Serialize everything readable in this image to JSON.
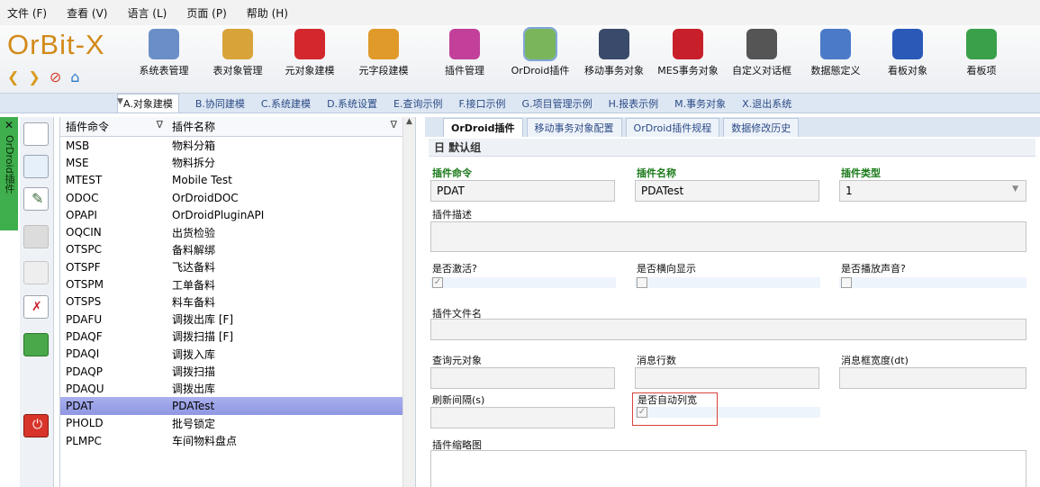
{
  "menu": [
    "文件 (F)",
    "查看 (V)",
    "语言 (L)",
    "页面 (P)",
    "帮助 (H)"
  ],
  "logo": "OrBit-X",
  "ribbon": [
    {
      "label": "系统表管理",
      "icon": "table-manage-icon",
      "color": "#6a8ec8"
    },
    {
      "label": "表对象管理",
      "icon": "table-object-icon",
      "color": "#d8a43a"
    },
    {
      "label": "元对象建模",
      "icon": "heart-icon",
      "color": "#d2282d"
    },
    {
      "label": "元字段建模",
      "icon": "puzzle-icon",
      "color": "#e09a2a"
    },
    {
      "label": "插件管理",
      "icon": "plugin-icon",
      "color": "#c2409a"
    },
    {
      "label": "OrDroid插件",
      "icon": "android-icon",
      "color": "#7ab55c"
    },
    {
      "label": "移动事务对象",
      "icon": "mobile-icon",
      "color": "#3a4a6a"
    },
    {
      "label": "MES事务对象",
      "icon": "mes-icon",
      "color": "#c8202a"
    },
    {
      "label": "自定义对话框",
      "icon": "dialog-icon",
      "color": "#555555"
    },
    {
      "label": "数据態定义",
      "icon": "tools-icon",
      "color": "#4a7ac8"
    },
    {
      "label": "看板对象",
      "icon": "monitor-icon",
      "color": "#2a5ab8"
    },
    {
      "label": "看板项",
      "icon": "stack-icon",
      "color": "#3aa04a"
    }
  ],
  "module_tabs": [
    "A.对象建模",
    "B.协同建模",
    "C.系统建模",
    "D.系统设置",
    "E.查询示例",
    "F.接口示例",
    "G.项目管理示例",
    "H.报表示例",
    "M.事务对象",
    "X.退出系统"
  ],
  "side_tab": "OrDroid插件",
  "list": {
    "col1": "插件命令",
    "col2": "插件名称",
    "rows": [
      [
        "MSB",
        "物料分箱"
      ],
      [
        "MSE",
        "物料拆分"
      ],
      [
        "MTEST",
        "Mobile Test"
      ],
      [
        "ODOC",
        "OrDroidDOC"
      ],
      [
        "OPAPI",
        "OrDroidPluginAPI"
      ],
      [
        "OQCIN",
        "出货检验"
      ],
      [
        "OTSPC",
        "备料解绑"
      ],
      [
        "OTSPF",
        "飞达备料"
      ],
      [
        "OTSPM",
        "工单备料"
      ],
      [
        "OTSPS",
        "料车备料"
      ],
      [
        "PDAFU",
        "调拨出库 [F]"
      ],
      [
        "PDAQF",
        "调拨扫描 [F]"
      ],
      [
        "PDAQI",
        "调拨入库"
      ],
      [
        "PDAQP",
        "调拨扫描"
      ],
      [
        "PDAQU",
        "调拨出库"
      ],
      [
        "PDAT",
        "PDATest"
      ],
      [
        "PHOLD",
        "批号锁定"
      ],
      [
        "PLMPC",
        "车间物料盘点"
      ]
    ],
    "selected_index": 15
  },
  "detail": {
    "tabs": [
      "OrDroid插件",
      "移动事务对象配置",
      "OrDroid插件规程",
      "数据修改历史"
    ],
    "group": "日 默认组",
    "labels": {
      "cmd": "插件命令",
      "name": "插件名称",
      "type": "插件类型",
      "desc": "插件描述",
      "active": "是否激活?",
      "landscape": "是否横向显示",
      "sound": "是否播放声音?",
      "file": "插件文件名",
      "query": "查询元对象",
      "msglines": "消息行数",
      "msgwidth": "消息框宽度(dt)",
      "refresh": "刷新间隔(s)",
      "autocol": "是否自动列宽",
      "thumb": "插件缩略图"
    },
    "values": {
      "cmd": "PDAT",
      "name": "PDATest",
      "type": "1",
      "active": true,
      "landscape": false,
      "sound": false,
      "autocol": true
    }
  }
}
